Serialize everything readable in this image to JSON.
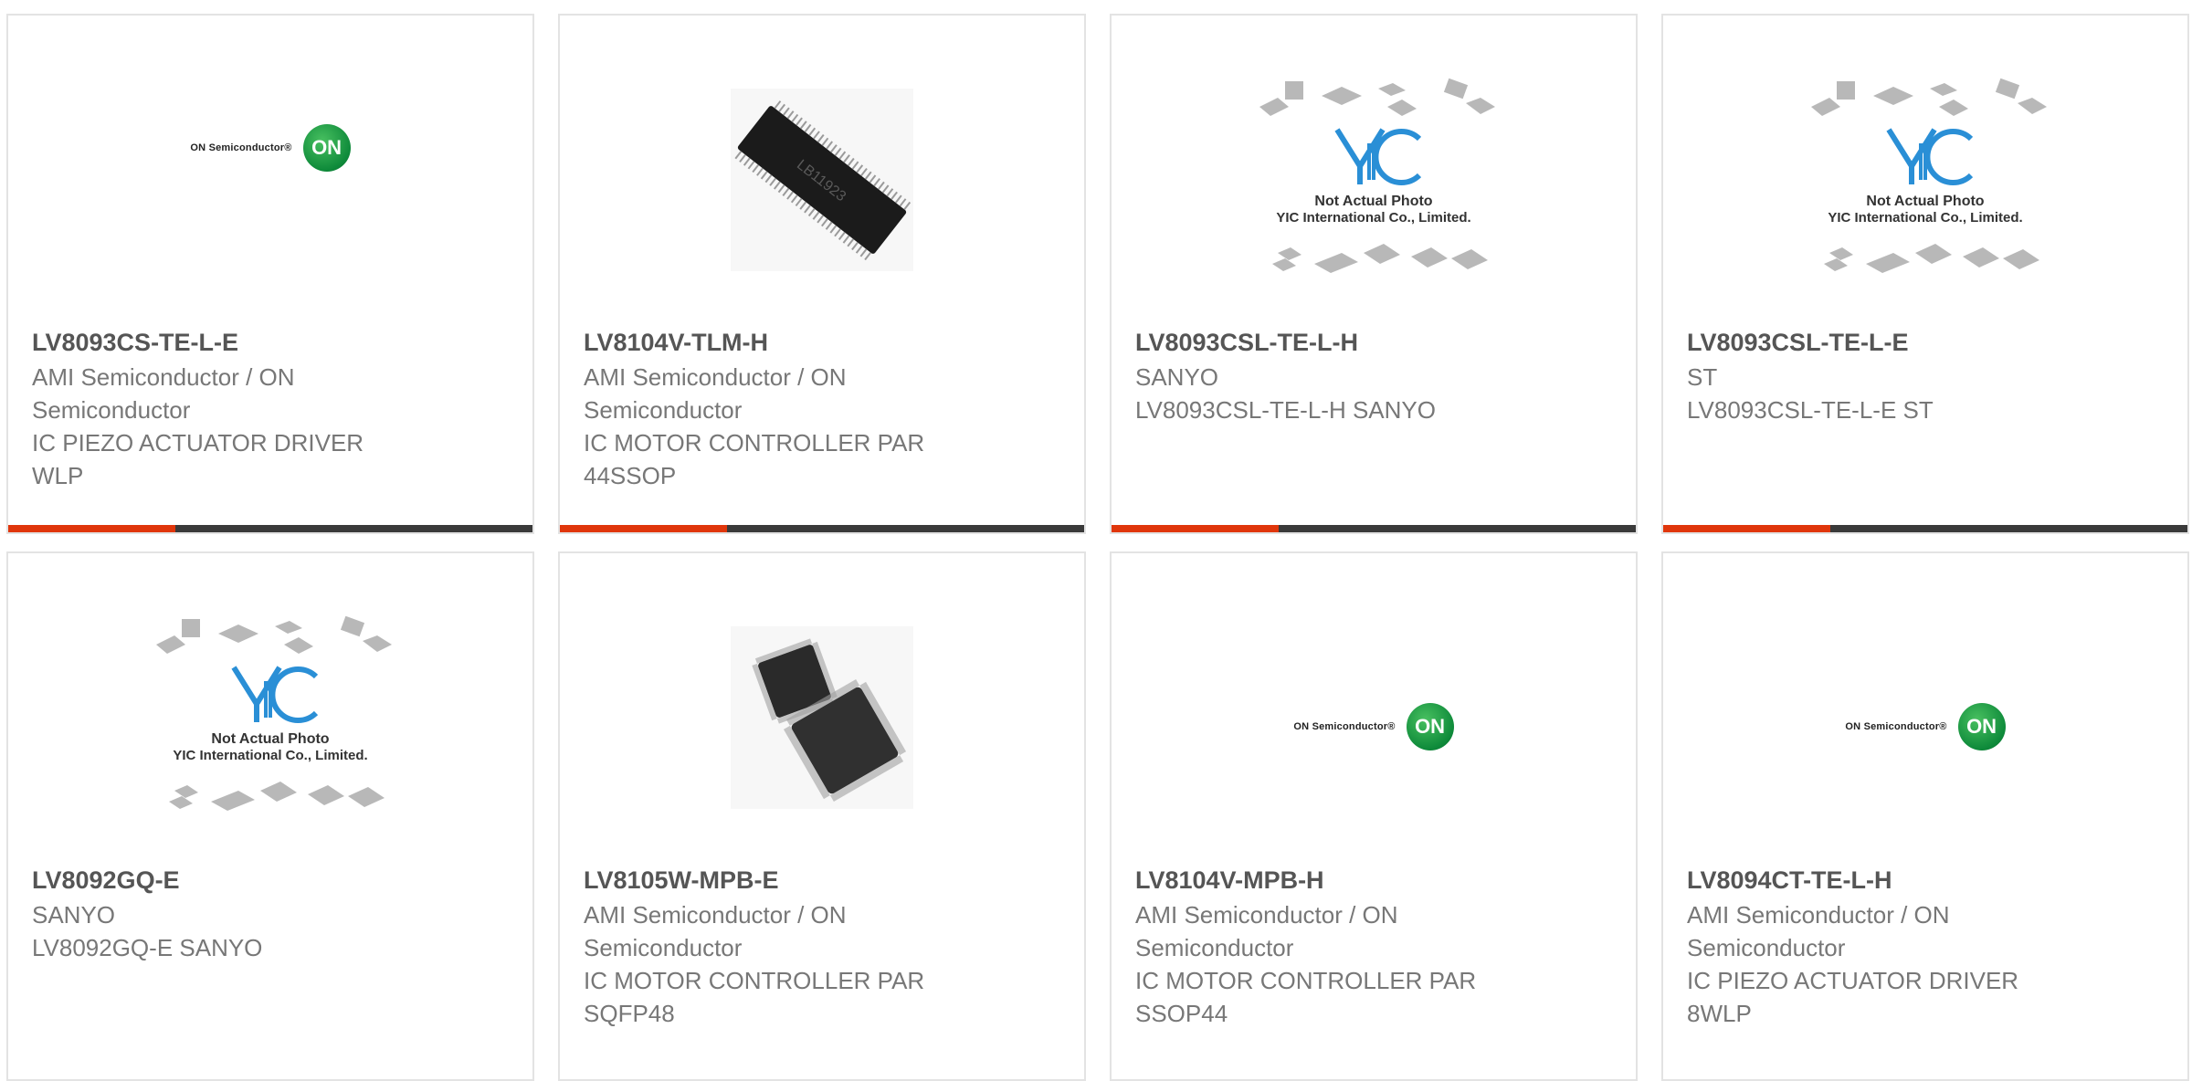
{
  "products": [
    {
      "part_number": "LV8093CS-TE-L-E",
      "manufacturer_line1": "AMI Semiconductor / ON",
      "manufacturer_line2": "Semiconductor",
      "desc_line1": "IC PIEZO ACTUATOR DRIVER",
      "desc_line2": "WLP",
      "image": "on-semiconductor-logo",
      "logo_text": "ON Semiconductor®",
      "logo_mark": "ON"
    },
    {
      "part_number": "LV8104V-TLM-H",
      "manufacturer_line1": "AMI Semiconductor / ON",
      "manufacturer_line2": "Semiconductor",
      "desc_line1": "IC MOTOR CONTROLLER PAR",
      "desc_line2": "44SSOP",
      "image": "ssop-chip-photo",
      "chip_marking": "LB11923"
    },
    {
      "part_number": "LV8093CSL-TE-L-H",
      "manufacturer_line1": "SANYO",
      "manufacturer_line2": "LV8093CSL-TE-L-H SANYO",
      "desc_line1": "",
      "desc_line2": "",
      "image": "yic-placeholder",
      "placeholder_line1": "Not Actual Photo",
      "placeholder_line2": "YIC International Co., Limited."
    },
    {
      "part_number": "LV8093CSL-TE-L-E",
      "manufacturer_line1": "ST",
      "manufacturer_line2": "LV8093CSL-TE-L-E ST",
      "desc_line1": "",
      "desc_line2": "",
      "image": "yic-placeholder",
      "placeholder_line1": "Not Actual Photo",
      "placeholder_line2": "YIC International Co., Limited."
    },
    {
      "part_number": "LV8092GQ-E",
      "manufacturer_line1": "SANYO",
      "manufacturer_line2": "LV8092GQ-E SANYO",
      "desc_line1": "",
      "desc_line2": "",
      "image": "yic-placeholder",
      "placeholder_line1": "Not Actual Photo",
      "placeholder_line2": "YIC International Co., Limited."
    },
    {
      "part_number": "LV8105W-MPB-E",
      "manufacturer_line1": "AMI Semiconductor / ON",
      "manufacturer_line2": "Semiconductor",
      "desc_line1": "IC MOTOR CONTROLLER PAR",
      "desc_line2": "SQFP48",
      "image": "qfp-chip-photo"
    },
    {
      "part_number": "LV8104V-MPB-H",
      "manufacturer_line1": "AMI Semiconductor / ON",
      "manufacturer_line2": "Semiconductor",
      "desc_line1": "IC MOTOR CONTROLLER PAR",
      "desc_line2": "SSOP44",
      "image": "on-semiconductor-logo",
      "logo_text": "ON Semiconductor®",
      "logo_mark": "ON"
    },
    {
      "part_number": "LV8094CT-TE-L-H",
      "manufacturer_line1": "AMI Semiconductor / ON",
      "manufacturer_line2": "Semiconductor",
      "desc_line1": "IC PIEZO ACTUATOR DRIVER",
      "desc_line2": "8WLP",
      "image": "on-semiconductor-logo",
      "logo_text": "ON Semiconductor®",
      "logo_mark": "ON"
    }
  ],
  "colors": {
    "accent": "#e0360b",
    "bar": "#3a3a3a",
    "title_text": "#555555",
    "body_text": "#777777",
    "on_green": "#0e8a3a",
    "yic_blue": "#2a8fd6"
  }
}
